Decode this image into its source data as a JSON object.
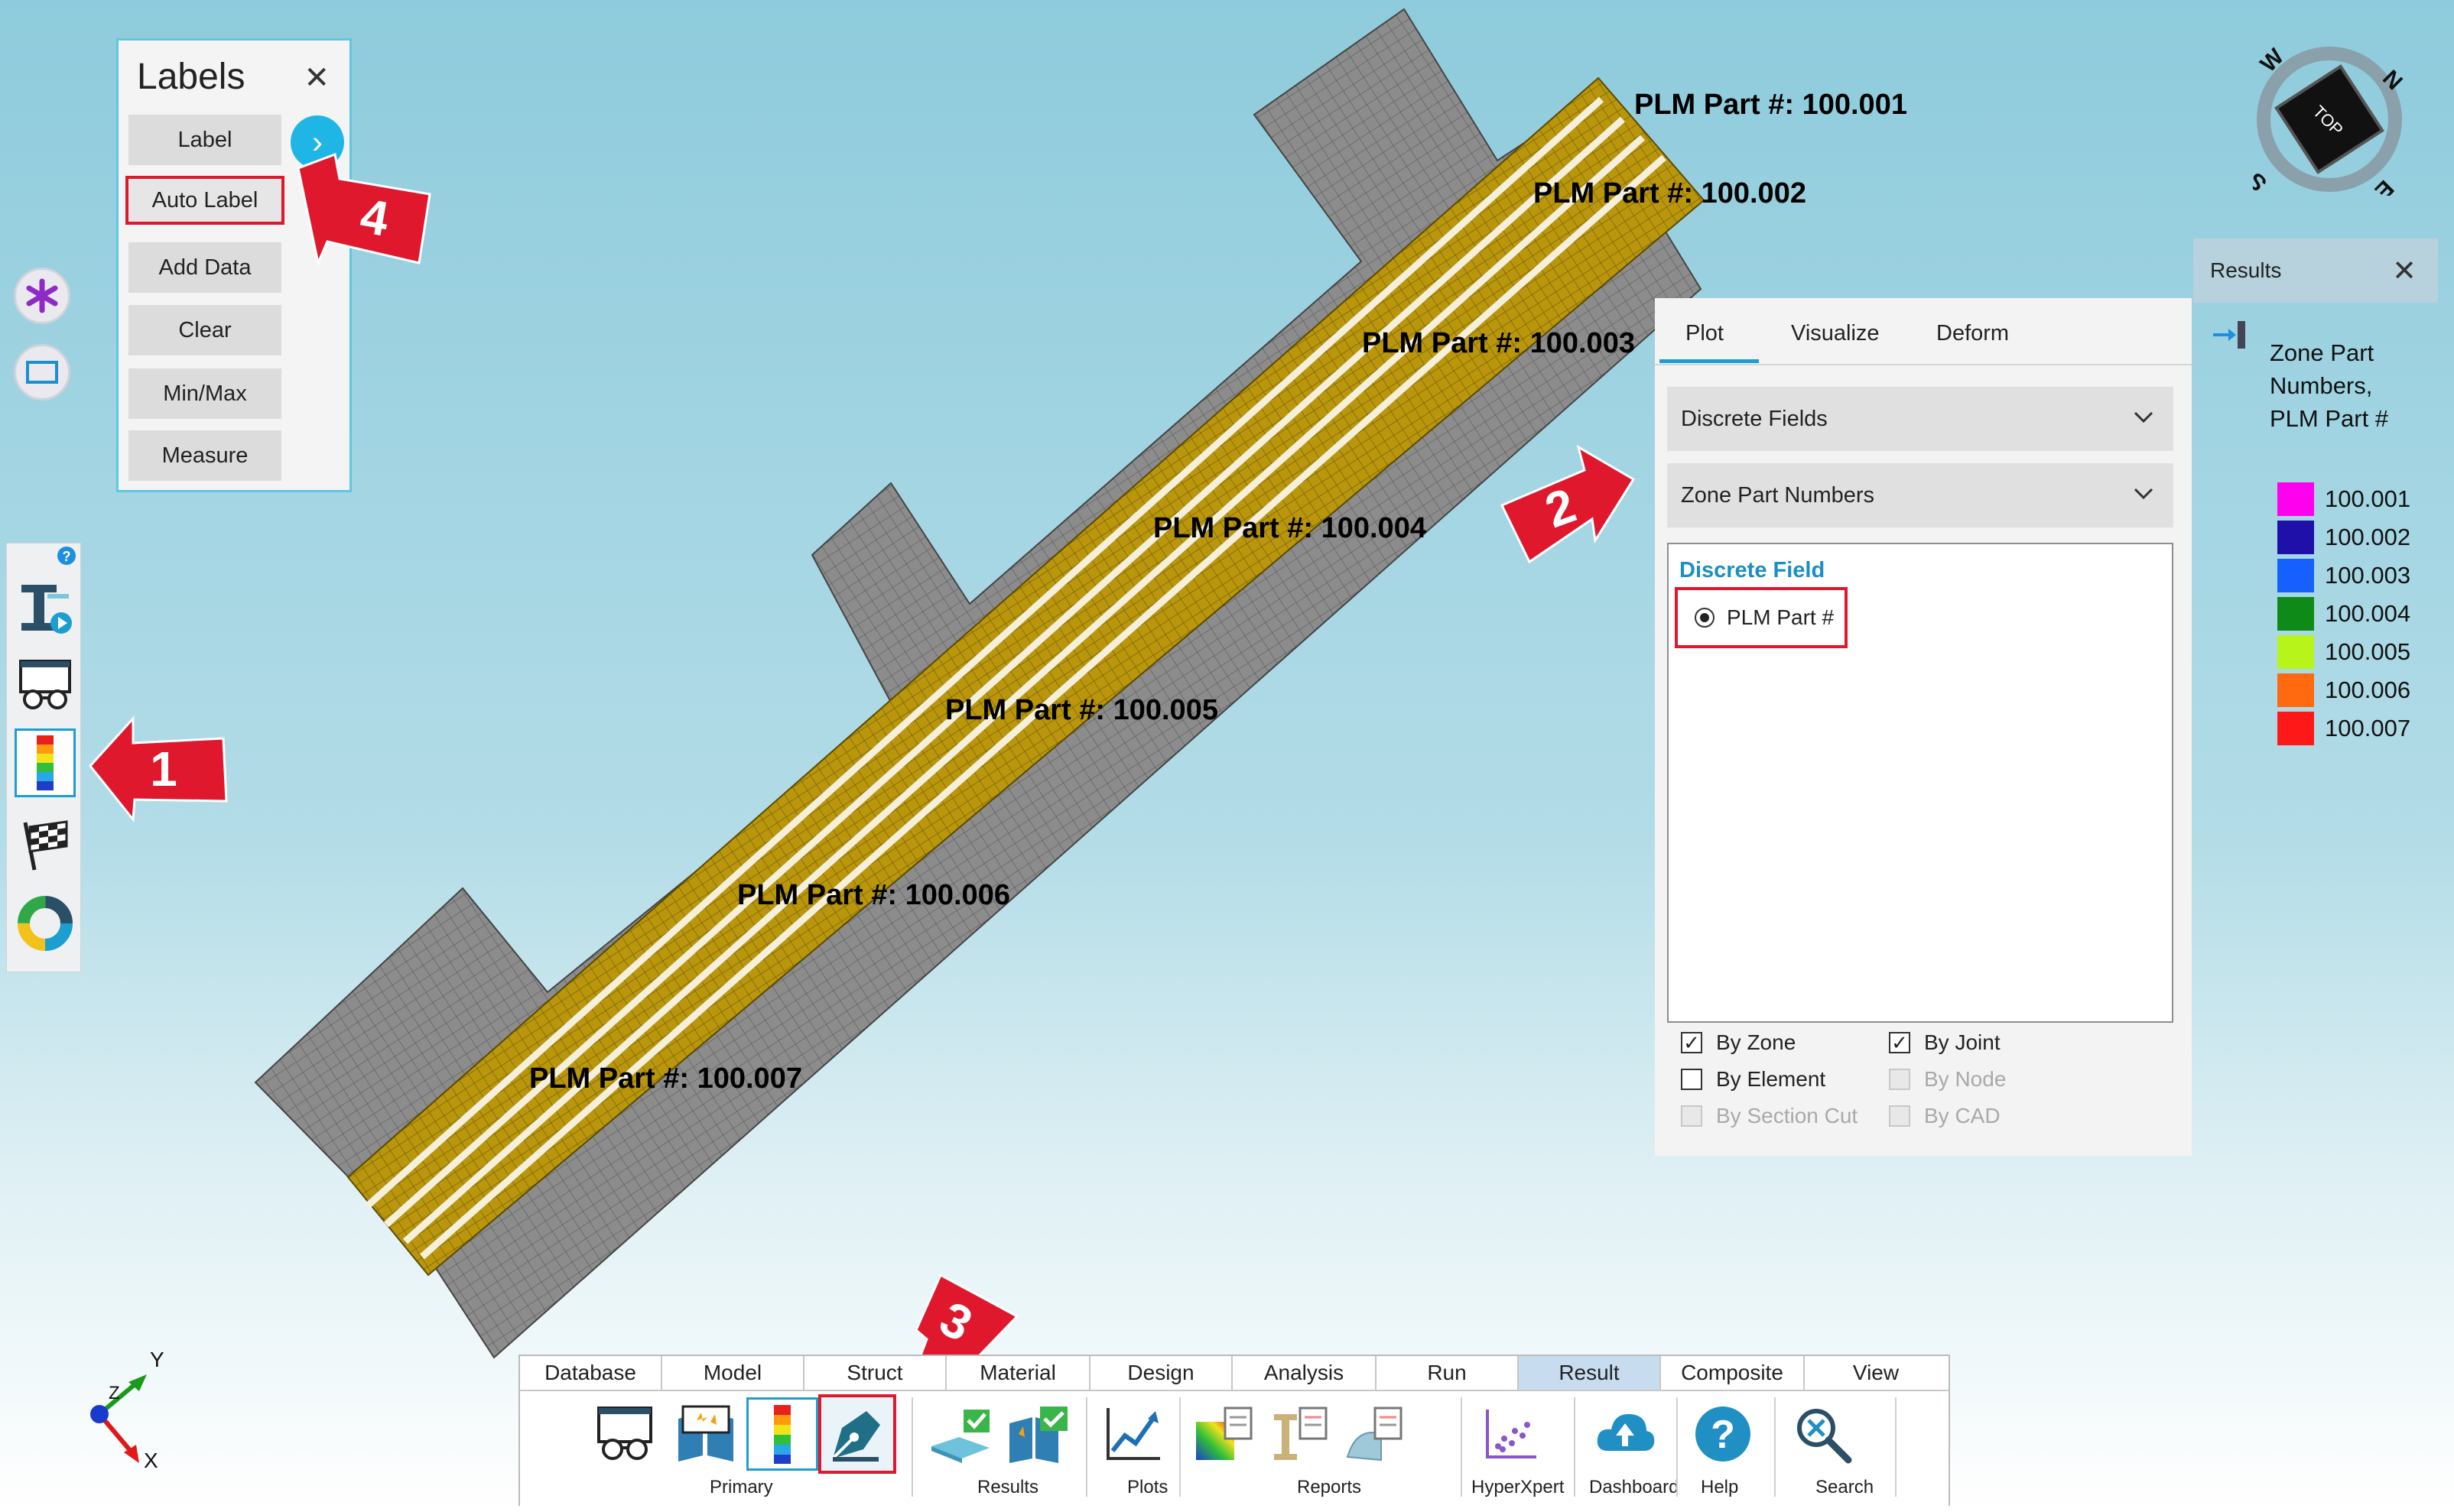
{
  "viewport": {
    "part_labels": [
      "PLM Part #: 100.001",
      "PLM Part #: 100.002",
      "PLM Part #: 100.003",
      "PLM Part #: 100.004",
      "PLM Part #: 100.005",
      "PLM Part #: 100.006",
      "PLM Part #: 100.007"
    ],
    "compass": {
      "n": "N",
      "e": "E",
      "s": "S",
      "w": "W",
      "face": "TOP"
    },
    "triad": {
      "x": "X",
      "y": "Y",
      "z": "Z"
    }
  },
  "labels_panel": {
    "title": "Labels",
    "close": "✕",
    "buttons": [
      "Label",
      "Auto Label",
      "Add Data",
      "Clear",
      "Min/Max",
      "Measure"
    ],
    "expand_icon": "›"
  },
  "callouts": [
    "1",
    "2",
    "3",
    "4"
  ],
  "plot_panel": {
    "tabs": [
      "Plot",
      "Visualize",
      "Deform"
    ],
    "active_tab": "Plot",
    "field_type_dropdown": "Discrete Fields",
    "field_dropdown": "Zone Part Numbers",
    "discrete_field_header": "Discrete Field",
    "radio_option": "PLM Part #",
    "checkboxes": {
      "by_zone": {
        "label": "By Zone",
        "checked": true
      },
      "by_joint": {
        "label": "By Joint",
        "checked": true
      },
      "by_element": {
        "label": "By Element",
        "checked": false
      },
      "by_node": {
        "label": "By Node",
        "checked": false,
        "disabled": true
      },
      "by_section_cut": {
        "label": "By Section Cut",
        "checked": false,
        "disabled": true
      },
      "by_cad": {
        "label": "By CAD",
        "checked": false,
        "disabled": true
      }
    }
  },
  "results_panel": {
    "title": "Results",
    "close": "✕",
    "legend_title_lines": [
      "Zone Part",
      "Numbers,",
      "PLM Part #"
    ],
    "legend": [
      {
        "label": "100.001",
        "color": "#ff00ee"
      },
      {
        "label": "100.002",
        "color": "#1e10a8"
      },
      {
        "label": "100.003",
        "color": "#1560ff"
      },
      {
        "label": "100.004",
        "color": "#0e8a18"
      },
      {
        "label": "100.005",
        "color": "#b6f41a"
      },
      {
        "label": "100.006",
        "color": "#ff6a10"
      },
      {
        "label": "100.007",
        "color": "#ff1818"
      }
    ]
  },
  "ribbon": {
    "tabs": [
      "Database",
      "Model",
      "Struct",
      "Material",
      "Design",
      "Analysis",
      "Run",
      "Result",
      "Composite",
      "View"
    ],
    "active_tab": "Result",
    "groups": [
      "Primary",
      "Results",
      "Plots",
      "Reports",
      "HyperXpert",
      "Dashboard",
      "Help",
      "Search"
    ]
  },
  "colors": {
    "accent": "#1d9ed1",
    "callout_red": "#e0182d",
    "panel_border": "#5fc7e0",
    "mesh_gray": "#8a8a8a",
    "strip_gold": "#b8950a"
  }
}
